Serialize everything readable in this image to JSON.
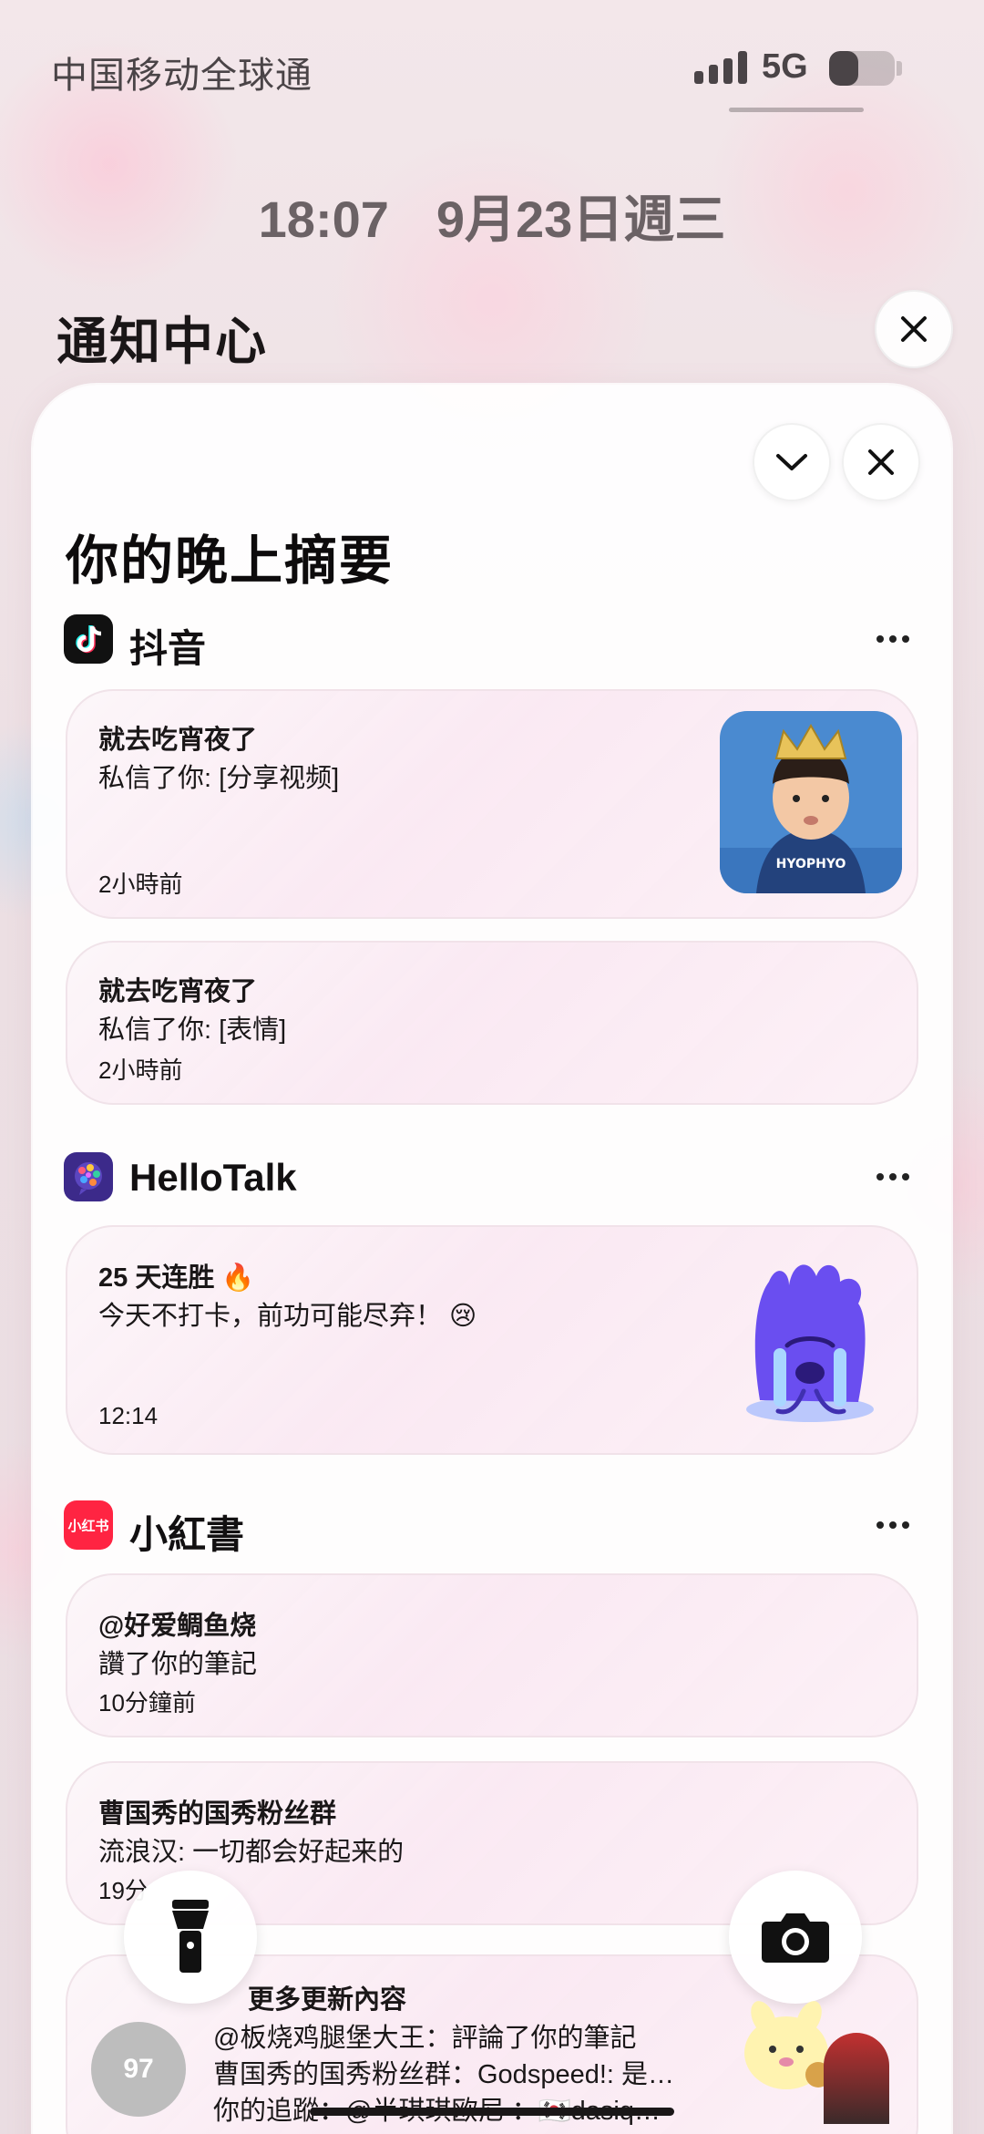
{
  "status_bar": {
    "carrier": "中国移动全球通",
    "network": "5G",
    "signal_bars": 4,
    "battery_level": 0.45
  },
  "lock": {
    "time": "18:07",
    "date": "9月23日週三"
  },
  "notification_center": {
    "title": "通知中心",
    "close_icon": "close-icon"
  },
  "summary": {
    "title": "你的晚上摘要",
    "collapse_icon": "chevron-down-icon",
    "close_icon": "close-icon"
  },
  "apps": {
    "douyin": {
      "name": "抖音",
      "notifications": [
        {
          "sender": "就去吃宵夜了",
          "message": "私信了你: [分享视频]",
          "time": "2小時前"
        },
        {
          "sender": "就去吃宵夜了",
          "message": "私信了你: [表情]",
          "time": "2小時前"
        }
      ]
    },
    "hellotalk": {
      "name": "HelloTalk",
      "notifications": [
        {
          "title": "25 天连胜 🔥",
          "message": "今天不打卡，前功可能尽弃！ 😢",
          "time": "12:14"
        }
      ]
    },
    "xiaohongshu": {
      "name": "小紅書",
      "icon_text": "小红书",
      "notifications": [
        {
          "sender": "@好爱鲷鱼烧",
          "message": "讚了你的筆記",
          "time": "10分鐘前"
        },
        {
          "sender": "曹国秀的国秀粉丝群",
          "message": "流浪汉: 一切都会好起来的",
          "time": "19分"
        }
      ],
      "stack": {
        "count": "97",
        "title": "更多更新內容",
        "lines": [
          "@板烧鸡腿堡大王：評論了你的筆記",
          "曹国秀的国秀粉丝群：Godspeed!: 是…",
          "你的追蹤：@半琪琪欧尼 ：🇰🇷dasiq…"
        ]
      }
    }
  },
  "controls": {
    "flashlight_icon": "flashlight-icon",
    "camera_icon": "camera-icon"
  },
  "colors": {
    "douyin_icon_bg": "#111111",
    "hellotalk_icon_bg": "#3c2a8a",
    "xiaohongshu_icon_bg": "#ff2442",
    "card_tint": "#fae8f2"
  }
}
